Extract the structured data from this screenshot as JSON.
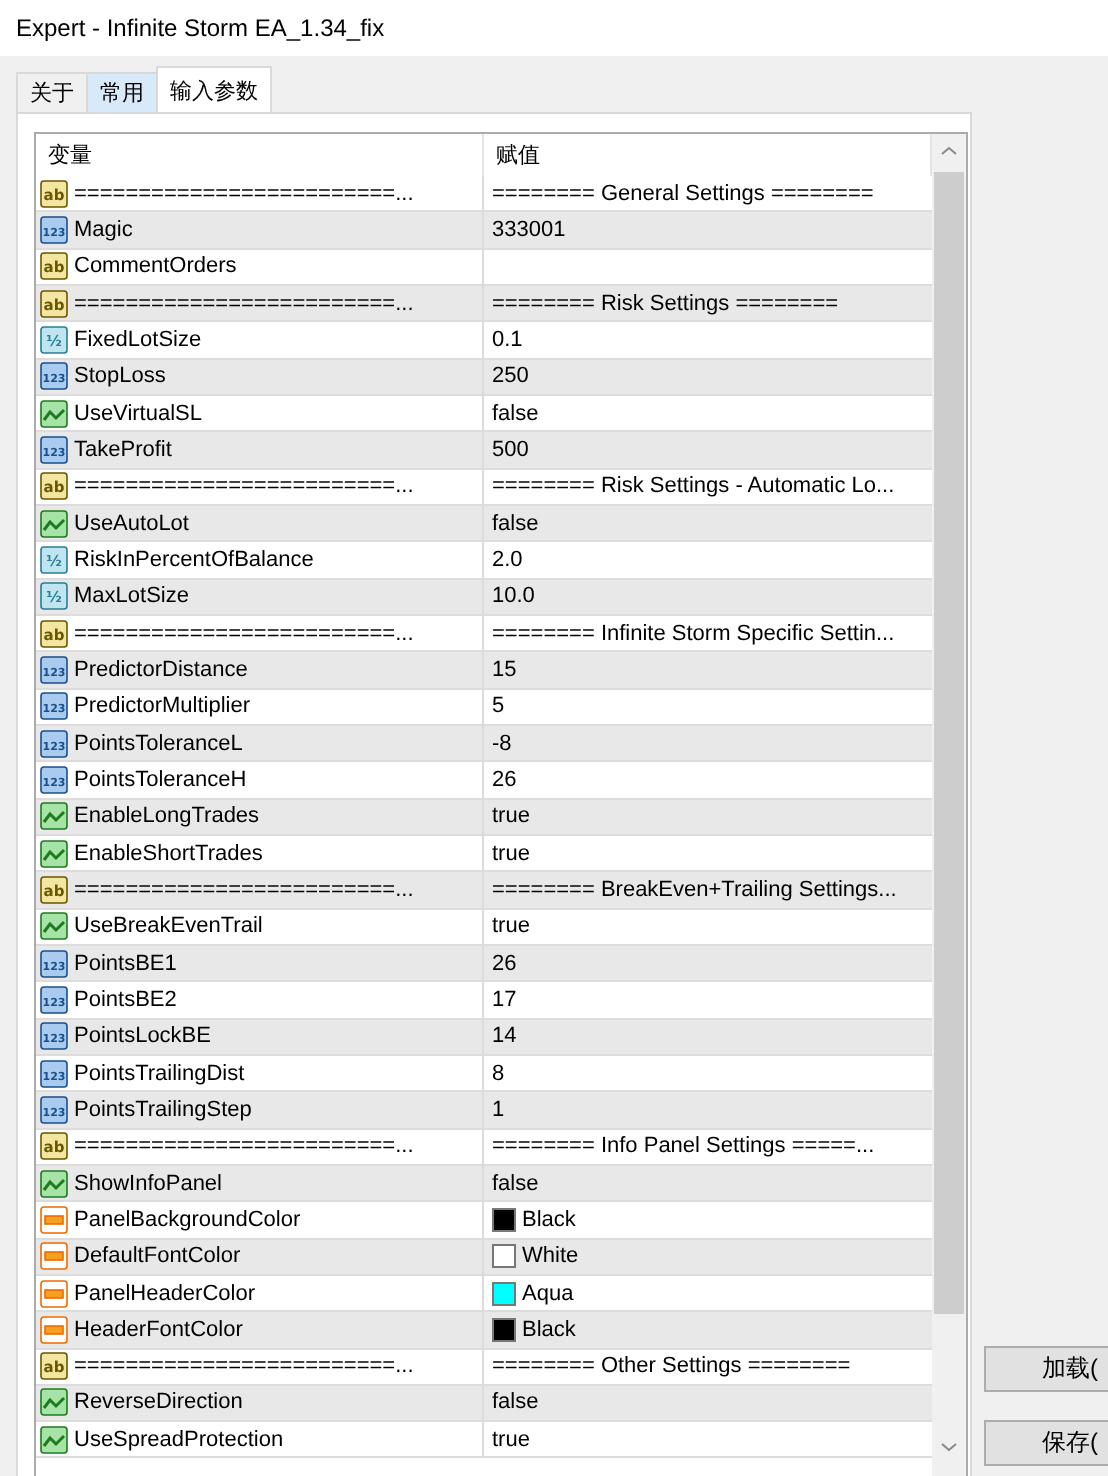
{
  "window": {
    "title": "Expert - Infinite Storm EA_1.34_fix"
  },
  "tabs": [
    {
      "label": "关于",
      "selected": false,
      "highlighted": false
    },
    {
      "label": "常用",
      "selected": false,
      "highlighted": true
    },
    {
      "label": "输入参数",
      "selected": true,
      "highlighted": false
    }
  ],
  "table": {
    "columns": [
      "变量",
      "赋值"
    ],
    "rows": [
      {
        "kind": "string",
        "badge": "ab",
        "name": "=========================...",
        "value": "======== General Settings ========"
      },
      {
        "kind": "int",
        "badge": "123",
        "name": "Magic",
        "value": "333001"
      },
      {
        "kind": "string",
        "badge": "ab",
        "name": "CommentOrders"
      },
      {
        "kind": "string",
        "badge": "ab",
        "name": "=========================...",
        "value": "======== Risk Settings ========"
      },
      {
        "kind": "double",
        "badge": "½",
        "name": "FixedLotSize",
        "value": "0.1"
      },
      {
        "kind": "int",
        "badge": "123",
        "name": "StopLoss",
        "value": "250"
      },
      {
        "kind": "bool",
        "name": "UseVirtualSL",
        "value": "false"
      },
      {
        "kind": "int",
        "badge": "123",
        "name": "TakeProfit",
        "value": "500"
      },
      {
        "kind": "string",
        "badge": "ab",
        "name": "=========================...",
        "value": "======== Risk Settings - Automatic Lo..."
      },
      {
        "kind": "bool",
        "name": "UseAutoLot",
        "value": "false"
      },
      {
        "kind": "double",
        "badge": "½",
        "name": "RiskInPercentOfBalance",
        "value": "2.0"
      },
      {
        "kind": "double",
        "badge": "½",
        "name": "MaxLotSize",
        "value": "10.0"
      },
      {
        "kind": "string",
        "badge": "ab",
        "name": "=========================...",
        "value": "======== Infinite Storm Specific Settin..."
      },
      {
        "kind": "int",
        "badge": "123",
        "name": "PredictorDistance",
        "value": "15"
      },
      {
        "kind": "int",
        "badge": "123",
        "name": "PredictorMultiplier",
        "value": "5"
      },
      {
        "kind": "int",
        "badge": "123",
        "name": "PointsToleranceL",
        "value": "-8"
      },
      {
        "kind": "int",
        "badge": "123",
        "name": "PointsToleranceH",
        "value": "26"
      },
      {
        "kind": "bool",
        "name": "EnableLongTrades",
        "value": "true"
      },
      {
        "kind": "bool",
        "name": "EnableShortTrades",
        "value": "true"
      },
      {
        "kind": "string",
        "badge": "ab",
        "name": "=========================...",
        "value": "======== BreakEven+Trailing Settings..."
      },
      {
        "kind": "bool",
        "name": "UseBreakEvenTrail",
        "value": "true"
      },
      {
        "kind": "int",
        "badge": "123",
        "name": "PointsBE1",
        "value": "26"
      },
      {
        "kind": "int",
        "badge": "123",
        "name": "PointsBE2",
        "value": "17"
      },
      {
        "kind": "int",
        "badge": "123",
        "name": "PointsLockBE",
        "value": "14"
      },
      {
        "kind": "int",
        "badge": "123",
        "name": "PointsTrailingDist",
        "value": "8"
      },
      {
        "kind": "int",
        "badge": "123",
        "name": "PointsTrailingStep",
        "value": "1"
      },
      {
        "kind": "string",
        "badge": "ab",
        "name": "=========================...",
        "value": "======== Info Panel Settings =====..."
      },
      {
        "kind": "bool",
        "name": "ShowInfoPanel",
        "value": "false"
      },
      {
        "kind": "color",
        "name": "PanelBackgroundColor",
        "value": "Black",
        "color": "#000000"
      },
      {
        "kind": "color",
        "name": "DefaultFontColor",
        "value": "White",
        "color": "#ffffff"
      },
      {
        "kind": "color",
        "name": "PanelHeaderColor",
        "value": "Aqua",
        "color": "#00ffff"
      },
      {
        "kind": "color",
        "name": "HeaderFontColor",
        "value": "Black",
        "color": "#000000"
      },
      {
        "kind": "string",
        "badge": "ab",
        "name": "=========================...",
        "value": "======== Other Settings ========"
      },
      {
        "kind": "bool",
        "name": "ReverseDirection",
        "value": "false"
      },
      {
        "kind": "bool",
        "name": "UseSpreadProtection",
        "value": "true"
      }
    ]
  },
  "buttons": [
    "加载(",
    "保存("
  ]
}
